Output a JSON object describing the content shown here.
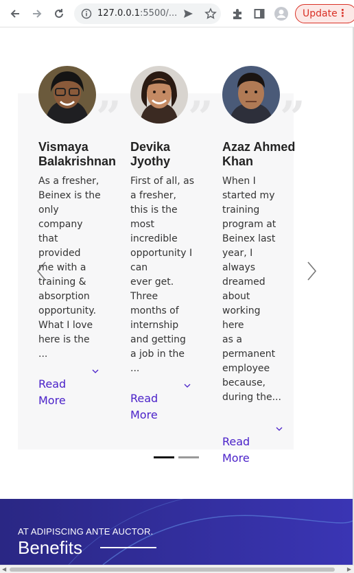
{
  "browser": {
    "url_host": "127.0.0.1",
    "url_rest": ":5500/...",
    "update_label": "Update",
    "icons": [
      "back-icon",
      "forward-icon",
      "reload-icon",
      "info-icon",
      "share-icon",
      "star-icon",
      "extensions-icon",
      "sidepanel-icon",
      "profile-icon",
      "menu-icon"
    ]
  },
  "testimonials": {
    "items": [
      {
        "name": "Vismaya\nBalakrishnan",
        "text": "As a fresher,\nBeinex is the\nonly\ncompany\nthat\nprovided\nme with a\ntraining &\nabsorption\nopportunity.\nWhat I love\nhere is the ...",
        "read_more": "Read\nMore"
      },
      {
        "name": "Devika\nJyothy",
        "text": "First of all, as\na fresher,\nthis is the\nmost\nincredible\nopportunity I\ncan\never get.\nThree\nmonths of internship\nand getting\na job in the\n...",
        "read_more": "Read\nMore"
      },
      {
        "name": "Azaz Ahmed\nKhan",
        "text": "When I\nstarted my\ntraining\nprogram at\nBeinex last\nyear, I\nalways\ndreamed\nabout\nworking\nhere\nas a\npermanent\nemployee\nbecause,\nduring the...",
        "read_more": "Read\nMore"
      }
    ],
    "quote_glyph": "”",
    "accent_color": "#4a21c9"
  },
  "benefits": {
    "kicker": "AT ADIPISCING ANTE AUCTOR.",
    "title": "Benefits"
  }
}
